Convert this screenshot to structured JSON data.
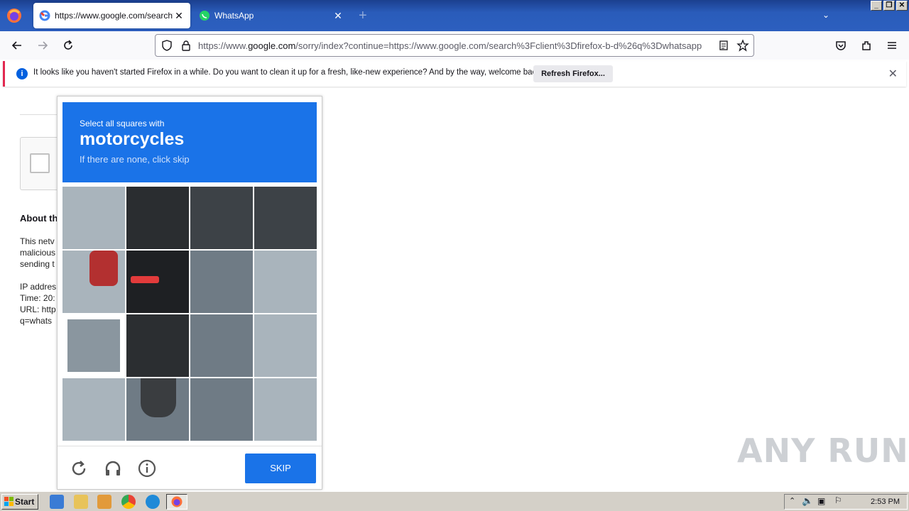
{
  "browser": {
    "tabs": [
      {
        "title": "https://www.google.com/search?c",
        "active": true
      },
      {
        "title": "WhatsApp",
        "active": false
      }
    ],
    "url": {
      "prefix": "https://www.",
      "domain": "google.com",
      "rest": "/sorry/index?continue=https://www.google.com/search%3Fclient%3Dfirefox-b-d%26q%3Dwhatsapp"
    },
    "notification": {
      "message": "It looks like you haven't started Firefox in a while. Do you want to clean it up for a fresh, like-new experience? And by the way, welcome back!",
      "button": "Refresh Firefox..."
    }
  },
  "page": {
    "about_heading": "About th",
    "body_lines": [
      "This netv",
      "malicious",
      "sending t"
    ],
    "info_lines": [
      "IP addres",
      "Time: 20:",
      "URL: http",
      "q=whats"
    ]
  },
  "captcha": {
    "instruction": "Select all squares with",
    "target": "motorcycles",
    "hint": "If there are none, click skip",
    "skip_label": "SKIP",
    "tiles": [
      "light",
      "dark",
      "dark",
      "dark",
      "light",
      "dark",
      "mid",
      "light",
      "selected",
      "dark",
      "mid",
      "light",
      "light",
      "mid",
      "mid",
      "light"
    ]
  },
  "watermark": "ANY RUN",
  "taskbar": {
    "start_label": "Start",
    "clock": "2:53 PM"
  },
  "colors": {
    "captcha_blue": "#1a73e8",
    "tab_strip": "#2a5cba",
    "notification_accent": "#e22850"
  }
}
